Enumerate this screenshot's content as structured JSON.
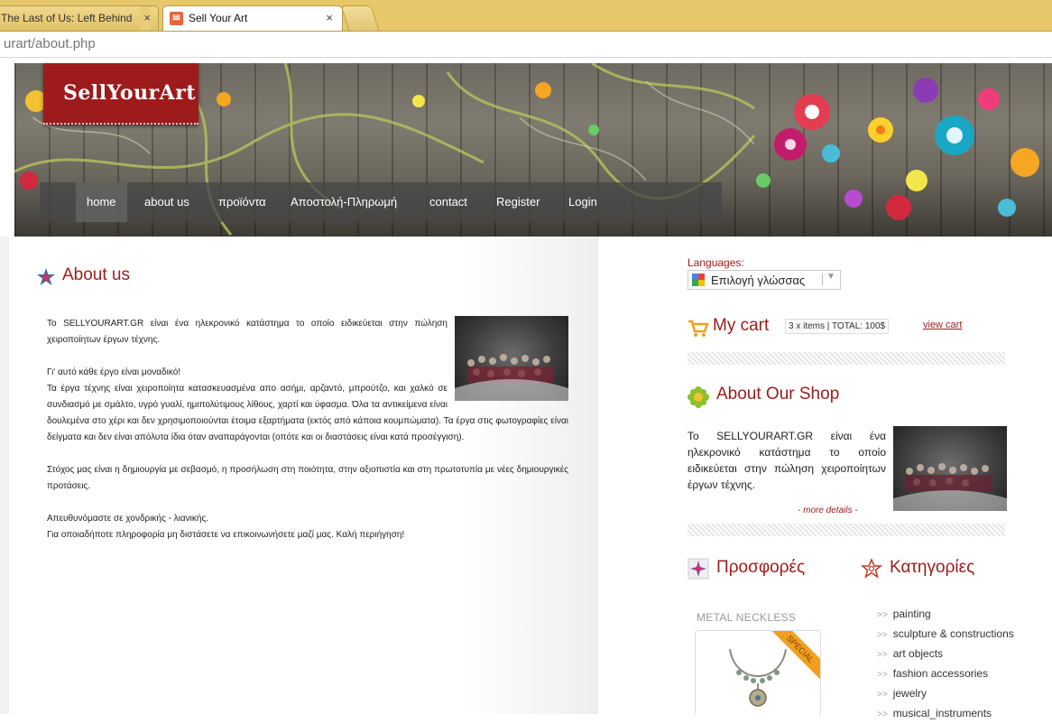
{
  "browser": {
    "tabs": [
      {
        "title": "The Last of Us: Left Behind",
        "close": "×"
      },
      {
        "title": "Sell Your Art",
        "close": "×"
      }
    ],
    "url": "urart/about.php"
  },
  "header": {
    "logo": "SellYourArt",
    "nav": [
      "home",
      "about us",
      "προϊόντα",
      "Αποστολή-Πληρωμή",
      "contact",
      "Register",
      "Login"
    ]
  },
  "about": {
    "title": "About us",
    "paragraphs": [
      "Το SELLYOURART.GR είναι ένα ηλεκρονικό κατάστημα το οποίο ειδικεύεται στην πώληση χειροποίητων έργων τέχνης.",
      "",
      "Γι' αυτό κάθε έργο είναι μοναδικό!",
      "Τα έργα τέχνης είναι χειροποίητα κατασκευασμένα απο ασήμι, αρζαντό, μπρούτζο, και χαλκό σε συνδιασμό με σμάλτο, υγρό γυαλί, ημιπολύτιμους λίθους, χαρτί και ύφασμα. Όλα τα αντικείμενα είναι δουλεμένα στο χέρι και δεν χρησιμοποιούνται έτοιμα εξαρτήματα (εκτός από κάποια κουμπώματα). Τα έργα στις φωτογραφίες είναι δείγματα και δεν είναι απόλυτα ίδια όταν αναπαράγονται (οπότε και οι διαστάσεις είναι κατά προσέγγιση).",
      "",
      "Στόχος μας είναι η δημιουργία με σεβασμό, η προσήλωση στη ποιότητα, στην αξιοπιστία και στη πρωτοτυπία με νέες δημιουργικές προτάσεις.",
      "",
      "Απευθυνόμαστε σε χονδρικής - λιανικής.",
      "Για οποιαδήποτε πληροφορία μη διστάσετε να επικοινωνήσετε μαζί μας. Καλή περιήγηση!"
    ]
  },
  "sidebar": {
    "languages_label": "Languages:",
    "language_select": "Επιλογή γλώσσας",
    "cart": {
      "title": "My cart",
      "summary": "3 x items | TOTAL: 100$",
      "view_link": "view cart"
    },
    "shop": {
      "title": "About Our Shop",
      "text": "Το SELLYOURART.GR είναι ένα ηλεκρονικό κατάστημα το οποίο ειδικεύεται στην πώληση χειροποίητων έργων τέχνης.",
      "more": "- more details -"
    },
    "offers": {
      "title": "Προσφορές",
      "product_name": "METAL NECKLESS",
      "ribbon": "SPECIAL"
    },
    "categories": {
      "title": "Κατηγορίες",
      "items": [
        "painting",
        "sculpture & constructions",
        "art objects",
        "fashion accessories",
        "jewelry",
        "musical_instruments"
      ]
    }
  },
  "colors": {
    "accent": "#9d1b1b",
    "tabbar": "#e6c86a",
    "nav_bg": "#464646"
  }
}
